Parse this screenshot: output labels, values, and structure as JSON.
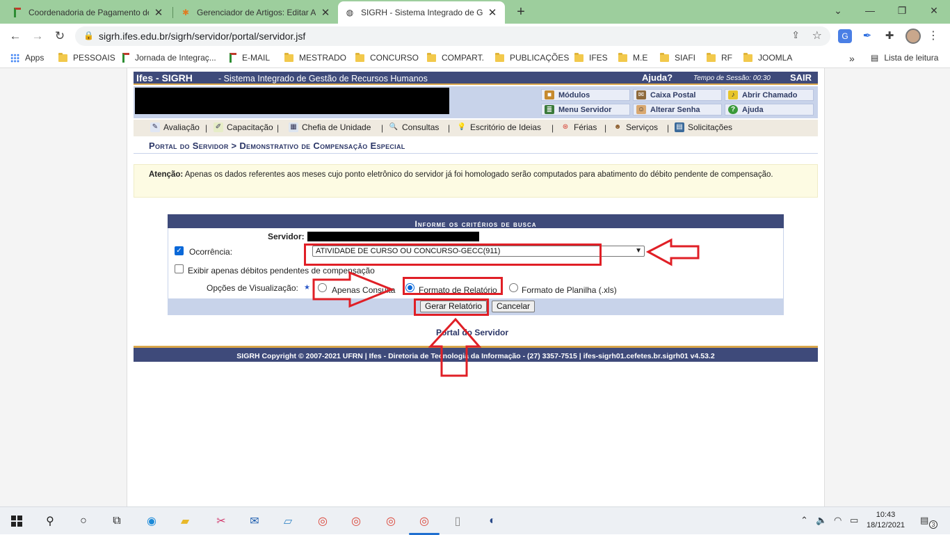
{
  "browser": {
    "tabs": [
      {
        "title": "Coordenadoria de Pagamento de",
        "active": false
      },
      {
        "title": "Gerenciador de Artigos: Editar Ar",
        "active": false
      },
      {
        "title": "SIGRH - Sistema Integrado de Ge",
        "active": true
      }
    ],
    "url": "sigrh.ifes.edu.br/sigrh/servidor/portal/servidor.jsf",
    "bookmarks": [
      "Apps",
      "PESSOAIS",
      "Jornada de Integraç...",
      "E-MAIL",
      "MESTRADO",
      "CONCURSO",
      "COMPART.",
      "PUBLICAÇÕES",
      "IFES",
      "M.E",
      "SIAFI",
      "RF",
      "JOOMLA"
    ],
    "reading_list": "Lista de leitura",
    "overflow": "»"
  },
  "sigrh": {
    "system": "Ifes - SIGRH",
    "system_name": "- Sistema Integrado de Gestão de Recursos Humanos",
    "help": "Ajuda?",
    "session": "Tempo de Sessão: 00:30",
    "logout": "SAIR",
    "quick_links": [
      "Módulos",
      "Caixa Postal",
      "Abrir Chamado",
      "Menu Servidor",
      "Alterar Senha",
      "Ajuda"
    ],
    "menu": [
      "Avaliação",
      "Capacitação",
      "Chefia de Unidade",
      "Consultas",
      "Escritório de Ideias",
      "Férias",
      "Serviços",
      "Solicitações"
    ],
    "breadcrumb": "Portal do Servidor > Demonstrativo de Compensação Especial",
    "alert_label": "Atenção:",
    "alert_text": "Apenas os dados referentes aos meses cujo ponto eletrônico do servidor já foi homologado serão computados para abatimento do débito pendente de compensação."
  },
  "form": {
    "title": "Informe os critérios de busca",
    "server_label": "Servidor:",
    "occurrence_label": "Ocorrência:",
    "occurrence_checked": true,
    "occurrence_value": "ATIVIDADE DE CURSO OU CONCURSO-GECC(911)",
    "pending_label": "Exibir apenas débitos pendentes de compensação",
    "pending_checked": false,
    "view_options_label": "Opções de Visualização:",
    "view_options": [
      "Apenas Consulta",
      "Formato de Relatório",
      "Formato de Planilha (.xls)"
    ],
    "view_selected": "Formato de Relatório",
    "submit": "Gerar Relatório",
    "cancel": "Cancelar"
  },
  "portal_link": "Portal do Servidor",
  "footer": "SIGRH Copyright © 2007-2021 UFRN | Ifes - Diretoria de Tecnologia da Informação - (27) 3357-7515 | ifes-sigrh01.cefetes.br.sigrh01 v4.53.2",
  "taskbar": {
    "time": "10:43",
    "date": "18/12/2021",
    "notifications": "3"
  },
  "colors": {
    "header": "#3e4a7a",
    "accent": "#d9a64b",
    "annotation": "#e01f26",
    "tabstrip": "#9dce9d"
  }
}
